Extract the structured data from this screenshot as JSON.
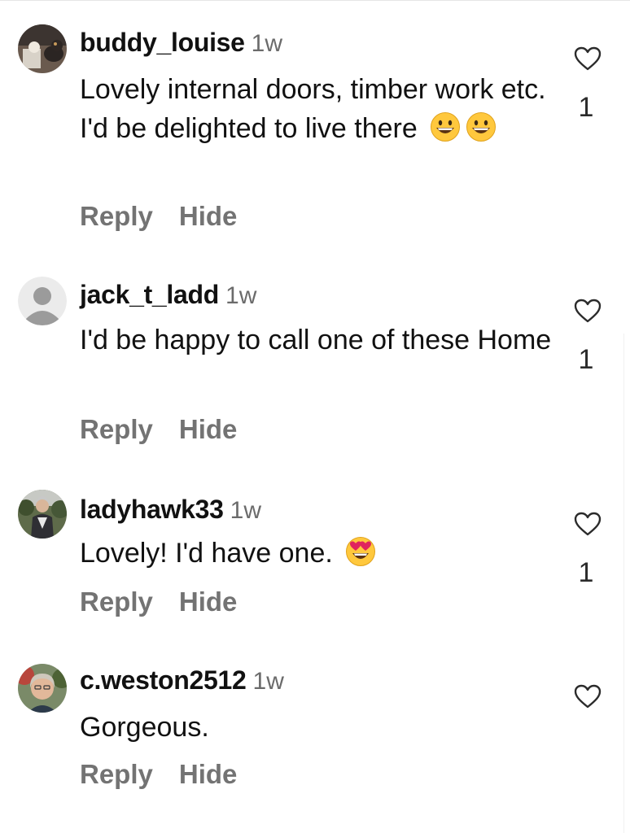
{
  "comments": [
    {
      "username": "buddy_louise",
      "time": "1w",
      "text": "Lovely internal doors, timber work etc. I'd be delighted to live there",
      "emojis": [
        "grinning-face",
        "grinning-face"
      ],
      "reply_label": "Reply",
      "hide_label": "Hide",
      "like_count": "1"
    },
    {
      "username": "jack_t_ladd",
      "time": "1w",
      "text": "I'd be happy to call one of these Home",
      "reply_label": "Reply",
      "hide_label": "Hide",
      "like_count": "1"
    },
    {
      "username": "ladyhawk33",
      "time": "1w",
      "text": "Lovely! I'd have one.",
      "emojis": [
        "heart-eyes-face"
      ],
      "reply_label": "Reply",
      "hide_label": "Hide",
      "like_count": "1"
    },
    {
      "username": "c.weston2512",
      "time": "1w",
      "text": "Gorgeous.",
      "reply_label": "Reply",
      "hide_label": "Hide",
      "like_count": ""
    }
  ],
  "colors": {
    "username": "#111111",
    "meta": "#737373",
    "emoji_yellow": "#FFC83D",
    "heart_red": "#E0245E"
  },
  "icons": {
    "like": "heart-outline-icon",
    "emoji_1": "grinning-face-emoji",
    "emoji_2": "heart-eyes-emoji"
  }
}
